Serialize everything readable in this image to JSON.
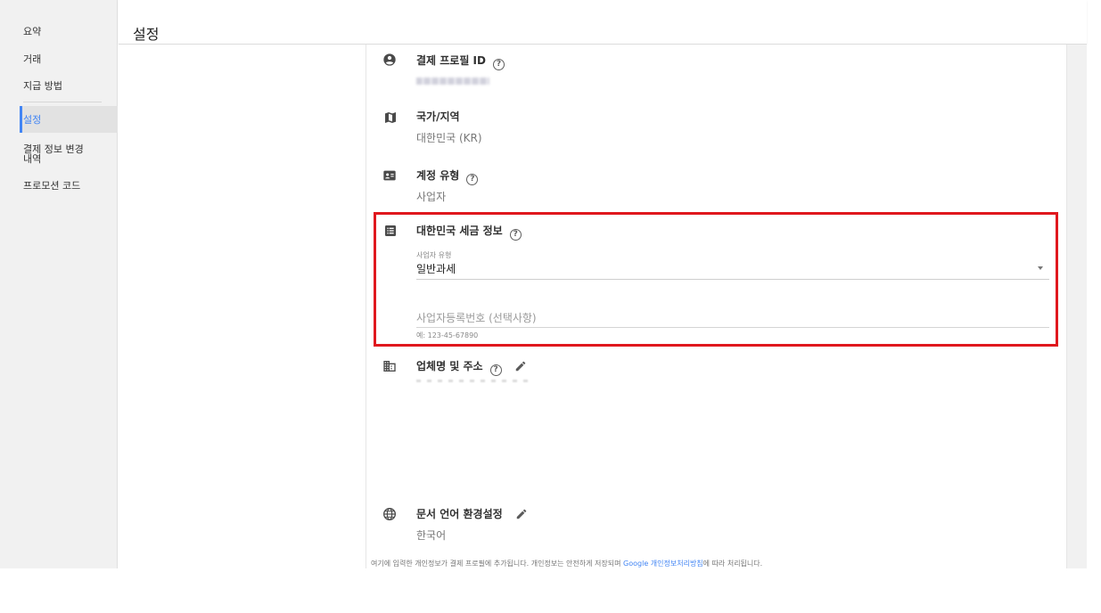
{
  "sidebar": {
    "items": [
      {
        "label": "요약"
      },
      {
        "label": "거래"
      },
      {
        "label": "지급 방법"
      },
      {
        "label": "설정"
      },
      {
        "label": "결제 정보 변경\n내역"
      },
      {
        "label": "프로모션 코드"
      }
    ],
    "active_item": "설정",
    "accent_color": "#4285f4"
  },
  "header": {
    "title": "설정"
  },
  "sections": {
    "profile_id": {
      "title": "결제 프로필 ID",
      "icon": "account-circle-icon"
    },
    "country": {
      "title": "국가/지역",
      "value": "대한민국 (KR)",
      "icon": "map-icon"
    },
    "account_type": {
      "title": "계정 유형",
      "value": "사업자",
      "icon": "contact-card-icon"
    },
    "tax_info": {
      "title": "대한민국 세금 정보",
      "icon": "list-document-icon",
      "business_type_label": "사업자 유형",
      "business_type_value": "일반과세",
      "registration_placeholder": "사업자등록번호 (선택사항)",
      "registration_hint": "예: 123-45-67890"
    },
    "company": {
      "title": "업체명 및 주소",
      "icon": "business-building-icon"
    },
    "doc_language": {
      "title": "문서 언어 환경설정",
      "value": "한국어",
      "icon": "globe-icon"
    }
  },
  "footer": {
    "text_before": "여기에 입력한 개인정보가 결제 프로필에 추가됩니다. 개인정보는 안전하게 저장되며 ",
    "link": "Google 개인정보처리방침",
    "text_after": "에 따라 처리됩니다."
  },
  "colors": {
    "highlight": "#e0181e",
    "link": "#4285f4"
  }
}
